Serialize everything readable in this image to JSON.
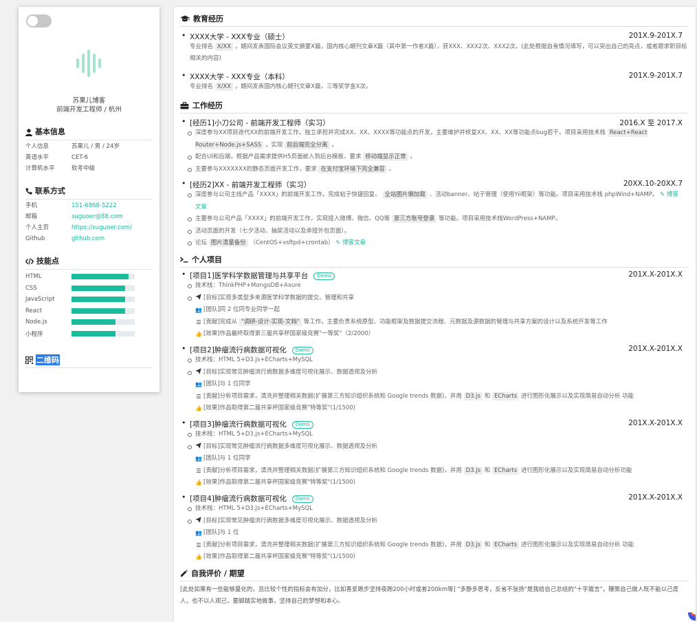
{
  "profile": {
    "name": "苏果儿博客",
    "title": "前端开发工程师 / 杭州",
    "colors": {
      "accent": "#1abc9c",
      "logo": "#a6e3cf"
    }
  },
  "basic": {
    "heading": "基本信息",
    "rows": [
      {
        "k": "个人信息",
        "v": "苏果儿 / 男 / 24岁"
      },
      {
        "k": "英语水平",
        "v": "CET-6"
      },
      {
        "k": "计算机水平",
        "v": "软考中级"
      }
    ]
  },
  "contact": {
    "heading": "联系方式",
    "rows": [
      {
        "k": "手机",
        "v": "151-6868-5222"
      },
      {
        "k": "邮箱",
        "v": "suguoer@88.com"
      },
      {
        "k": "个人主页",
        "v": "https://suguoer.com/"
      },
      {
        "k": "Github",
        "v": "github.com"
      }
    ]
  },
  "skills": {
    "heading": "技能点",
    "rows": [
      {
        "k": "HTML",
        "level": 90
      },
      {
        "k": "CSS",
        "level": 85
      },
      {
        "k": "JavaScript",
        "level": 85
      },
      {
        "k": "React",
        "level": 85
      },
      {
        "k": "Node.js",
        "level": 70
      },
      {
        "k": "小程序",
        "level": 70
      }
    ]
  },
  "qr": {
    "heading": "二维码"
  },
  "education": {
    "heading": "教育经历",
    "items": [
      {
        "title": "XXXX大学 - XXX专业（硕士）",
        "date": "201X.9-201X.7",
        "desc_pre": "专业排名",
        "desc_tag": "X/XX",
        "desc_post": "，期间发表国际会议英文摘要X篇，国内核心期刊文章X篇（其中第一作者X篇），获XXX、XXX2次、XXX2次。(此处根据自身情况填写，可以突出自己的亮点，或者跟求职目标相关的内容)"
      },
      {
        "title": "XXXX大学 - XXX专业（本科）",
        "date": "201X.9-201X.7",
        "desc_pre": "专业排名",
        "desc_tag": "X/XX",
        "desc_post": "，期间发表国内核心期刊文章X篇，三等奖学金X次。"
      }
    ]
  },
  "work": {
    "heading": "工作经历",
    "items": [
      {
        "title": "[经历1]小刀公司 - 前端开发工程师（实习）",
        "date": "2016.X 至 2017.X",
        "l1_pre": "深度参与XX项目迭代XX的前端开发工作，独立承担并完成XX、XX、XXXX等功能点的开发，主要维护并修复XX、XX、XX等功能点bug若干。项目采用技术栈",
        "l1_tag1": "React+React Router+Node.js+SASS",
        "l1_mid": "，实现",
        "l1_tag2": "前后端完全分离",
        "l1_post": "。",
        "l2_pre": "配合UI和后端，根据产品需求提供H5页面嵌入到后台模板，要求",
        "l2_tag": "移动端显示正常",
        "l2_post": "。",
        "l3_pre": "主要参与XXXXXXX的静态页面开发工作，要求",
        "l3_tag": "在支付宝环境下完全兼容",
        "l3_post": "。"
      },
      {
        "title": "[经历2]XX - 前端开发工程师（实习）",
        "date": "20XX.10-20XX.7",
        "l1_pre": "深度参与公司主线产品「XXXX」的前端开发工作，完成帖子快捷回复、",
        "l1_tag": "全站图片懒加载",
        "l1_post": "、活动banner、帖子管理（使用Yii框架）等功能。项目采用技术栈 phpWind+NAMP。",
        "l1_link": "博客文章",
        "l2_pre": "主要参与公司产品「XXXX」的前端开发工作，实现接入微博、微信、QQ等",
        "l2_tag": "第三方账号登录",
        "l2_post": "等功能。项目采用技术栈WordPress+NAMP。",
        "l3": "活动页面的开发（七夕活动、抽奖活动以及承接外包页面）。",
        "l4_pre": "论坛",
        "l4_tag": "图片清量备份",
        "l4_post": "（CentOS+vsftpd+crontab）",
        "l4_link": "博客文章"
      }
    ]
  },
  "projects": {
    "heading": "个人项目",
    "demo_label": "Demo",
    "items": [
      {
        "title": "[项目1]医学科学数据管理与共享平台",
        "date": "201X.X-201X.X",
        "tech": "技术栈：ThinkPHP+MongoDB+Axure",
        "goal": "[目标]实现多类型多来源医学科学数据的提交、管理和共享",
        "team": "[团队]同 2 位同专业同学一起",
        "contrib_pre": "[贡献]完成从",
        "contrib_tag": "\"调研-设计-实现-文档\"",
        "contrib_post": "等工作，主要负责系统原型、功能框架及数据提交流程、元数据及源数据的管理与共享方案的设计以及系统开发等工作",
        "effect": "[效果]作品最终取得第三届共享杯国家级竞赛\"一等奖\"（2/2000）"
      },
      {
        "title": "[项目2]肿瘤流行病数据可视化",
        "date": "201X.X-201X.X",
        "tech": "技术栈：HTML 5+D3.js+ECharts+MySQL",
        "goal": "[目标]实现常见肿瘤流行病数据多维度可视化展示、数据透视及分析",
        "team": "[团队]与 1 位同学",
        "contrib_pre": "[贡献]分析项目需求，清洗并整理相关数据(扩展第三方知识组织系统和 Google trends 数据)，并用",
        "contrib_tag": "D3.js",
        "contrib_mid": "和",
        "contrib_tag2": "ECharts",
        "contrib_post": "进行图形化展示以及实现简易自动分析 功能",
        "effect": "[效果]作品取得第二届共享杯国家级竞赛\"特等奖\"(1/1500)"
      },
      {
        "title": "[项目3]肿瘤流行病数据可视化",
        "date": "201X.X-201X.X",
        "tech": "技术栈：HTML 5+D3.js+ECharts+MySQL",
        "goal": "[目标]实现常见肿瘤流行病数据多维度可视化展示、数据透视及分析",
        "team": "[团队]与 1 位同学",
        "contrib_pre": "[贡献]分析项目需求，清洗并整理相关数据(扩展第三方知识组织系统和 Google trends 数据)，并用",
        "contrib_tag": "D3.js",
        "contrib_mid": "和",
        "contrib_tag2": "ECharts",
        "contrib_post": "进行图形化展示以及实现简易自动分析功能",
        "effect": "[效果]作品取得第二届共享杯国家级竞赛\"特等奖\"(1/1500)"
      },
      {
        "title": "[项目4]肿瘤流行病数据可视化",
        "date": "201X.X-201X.X",
        "tech": "技术栈：HTML 5+D3.js+ECharts+MySQL",
        "goal": "[目标]实现常见肿瘤流行病数据多维度可视化展示、数据透视及分析",
        "team": "[团队]与 1 位",
        "contrib_pre": "[贡献]分析项目需求，清洗并整理相关数据(扩展第三方知识组织系统和 Google trends 数据)，并用",
        "contrib_tag": "D3.js",
        "contrib_mid": "和",
        "contrib_tag2": "ECharts",
        "contrib_post": "进行图形化展示以及实现简易自动分析 功能",
        "effect": "[效果]作品取得第二届共享杯国家级竞赛\"特等奖\"(1/1500)"
      }
    ]
  },
  "self": {
    "heading": "自我评价 / 期望",
    "text": "[此处如果有一些能够量化的，且比较个性的指标会有加分，比如喜爱跑步坚持夜跑200小时或者200km等] \"多静多思考，反省不张扬\"是我给自己总结的\"十字箴言\"，鞭策自己做人既不能以己度人，也不以人观己，要脚踏实地做事，坚持自己的梦想和本心。"
  }
}
